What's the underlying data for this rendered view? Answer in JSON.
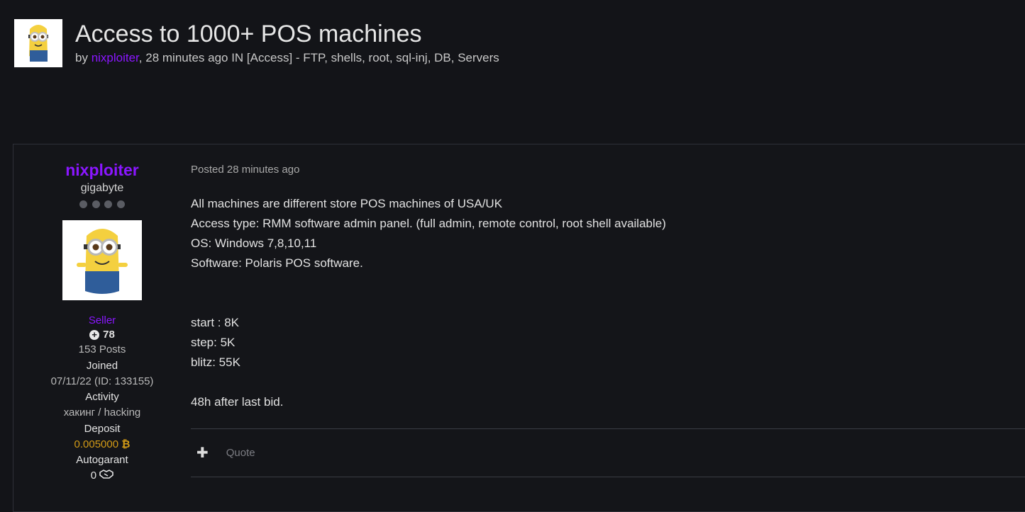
{
  "thread": {
    "title": "Access to 1000+ POS machines",
    "by": "by ",
    "author": "nixploiter",
    "meta": ", 28 minutes ago IN [Access] - FTP, shells, root, sql-inj, DB, Servers"
  },
  "author_panel": {
    "name": "nixploiter",
    "title": "gigabyte",
    "group": "Seller",
    "reputation": "78",
    "posts": "153 Posts",
    "joined_label": "Joined",
    "joined_value": "07/11/22 (ID: 133155)",
    "activity_label": "Activity",
    "activity_value": "хакинг / hacking",
    "deposit_label": "Deposit",
    "deposit_value": "0.005000",
    "autogarant_label": "Autogarant",
    "autogarant_value": "0"
  },
  "post": {
    "posted": "Posted 28 minutes ago",
    "lines": [
      "All machines are different store POS machines of USA/UK",
      "Access type: RMM software admin panel. (full admin, remote control, root shell available)",
      "OS: Windows 7,8,10,11",
      "Software: Polaris POS software."
    ],
    "bid_lines": [
      "start : 8K",
      "step: 5K",
      "blitz: 55K"
    ],
    "closing": "48h after last bid.",
    "quote_label": "Quote"
  },
  "colors": {
    "background": "#131418",
    "accent_purple": "#8a16ff",
    "deposit_gold": "#d39b16"
  },
  "icons": {
    "plus": "plus-icon",
    "reputation": "plus-circle-icon",
    "bitcoin": "bitcoin-icon",
    "autogarant": "handshake-icon"
  }
}
